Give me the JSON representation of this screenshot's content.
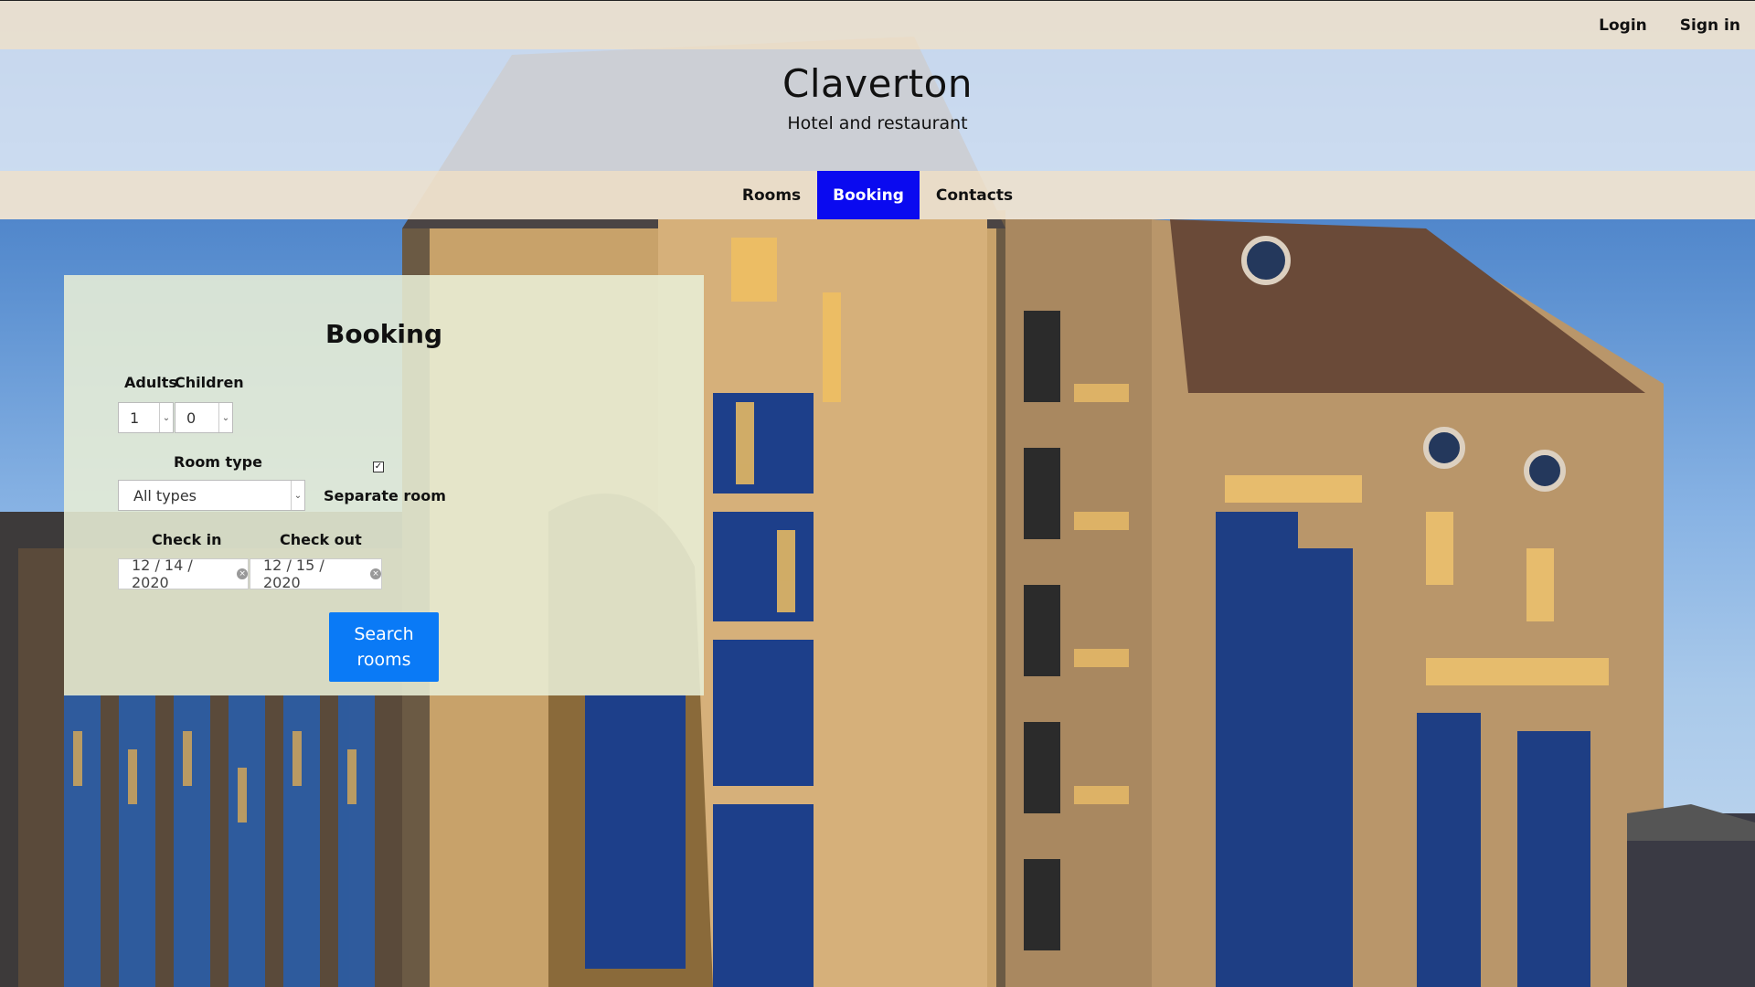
{
  "header": {
    "login_label": "Login",
    "signin_label": "Sign in"
  },
  "brand": {
    "title": "Claverton",
    "subtitle": "Hotel and restaurant"
  },
  "nav": {
    "items": [
      {
        "label": "Rooms"
      },
      {
        "label": "Booking"
      },
      {
        "label": "Contacts"
      }
    ],
    "active": "Booking"
  },
  "booking": {
    "title": "Booking",
    "adults_label": "Adults",
    "children_label": "Children",
    "adults_value": "1",
    "children_value": "0",
    "room_type_label": "Room type",
    "room_type_value": "All types",
    "separate_room_label": "Separate room",
    "separate_room_checked": true,
    "checkin_label": "Check in",
    "checkout_label": "Check out",
    "checkin_value": "12 / 14 / 2020",
    "checkout_value": "12 / 15 / 2020",
    "search_label_line1": "Search",
    "search_label_line2": "rooms"
  },
  "colors": {
    "nav_active": "#0a0af0",
    "search_button": "#0a7af6",
    "bar_beige": "#f5e7d2"
  }
}
